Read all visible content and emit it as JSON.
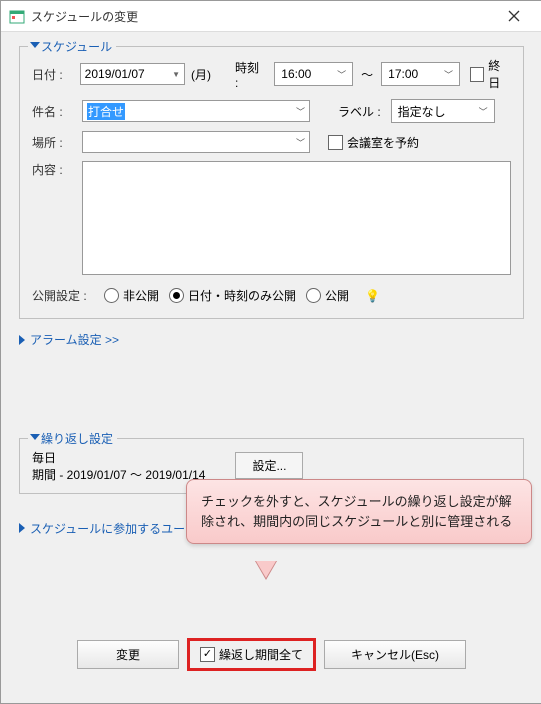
{
  "window": {
    "title": "スケジュールの変更"
  },
  "schedule": {
    "legend": "スケジュール",
    "date_label": "日付 :",
    "date_value": "2019/01/07",
    "day_of_week": "(月)",
    "time_label": "時刻 :",
    "time_start": "16:00",
    "time_end": "17:00",
    "time_sep": "～",
    "allday_label": "終日",
    "subject_label": "件名 :",
    "subject_value": "打合せ",
    "tag_label": "ラベル :",
    "tag_value": "指定なし",
    "place_label": "場所 :",
    "place_value": "",
    "reserve_room_label": "会議室を予約",
    "content_label": "内容 :",
    "visibility_label": "公開設定 :",
    "visibility_options": {
      "private": "非公開",
      "dateonly": "日付・時刻のみ公開",
      "public": "公開"
    }
  },
  "alarm_link": "アラーム設定 >>",
  "repeat": {
    "legend": "繰り返し設定",
    "pattern": "毎日",
    "period": "期間 - 2019/01/07 ～ 2019/01/14",
    "settings_button": "設定..."
  },
  "participants_link": "スケジュールに参加するユー",
  "callout_text": "チェックを外すと、スケジュールの繰り返し設定が解除され、期間内の同じスケジュールと別に管理される",
  "footer": {
    "change": "変更",
    "repeat_all": "繰返し期間全て",
    "cancel": "キャンセル(Esc)"
  }
}
